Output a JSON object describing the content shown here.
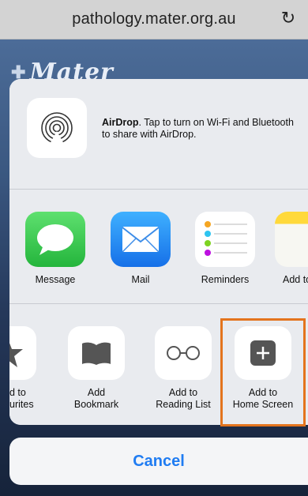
{
  "browser": {
    "url": "pathology.mater.org.au",
    "reload_icon": "reload-icon"
  },
  "background_page": {
    "logo_text": "Mater"
  },
  "share_sheet": {
    "airdrop": {
      "icon": "airdrop-icon",
      "title": "AirDrop",
      "description": ". Tap to turn on Wi-Fi and Bluetooth to share with AirDrop."
    },
    "apps": [
      {
        "label": "Message",
        "icon": "message-icon",
        "color": "#33c24d"
      },
      {
        "label": "Mail",
        "icon": "mail-icon",
        "color": "#1d8cf5"
      },
      {
        "label": "Reminders",
        "icon": "reminders-icon",
        "color": "#ffffff"
      },
      {
        "label": "Add to",
        "icon": "notes-icon",
        "color": "#ffcc1a"
      }
    ],
    "actions": [
      {
        "label": "d to\nurites",
        "icon": "star-icon"
      },
      {
        "label": "Add\nBookmark",
        "icon": "bookmark-icon"
      },
      {
        "label": "Add to\nReading List",
        "icon": "reading-list-icon"
      },
      {
        "label": "Add to\nHome Screen",
        "icon": "add-home-screen-icon"
      }
    ],
    "highlight_color": "#e3741d"
  },
  "cancel_label": "Cancel",
  "colors": {
    "accent": "#1f7cf2"
  }
}
